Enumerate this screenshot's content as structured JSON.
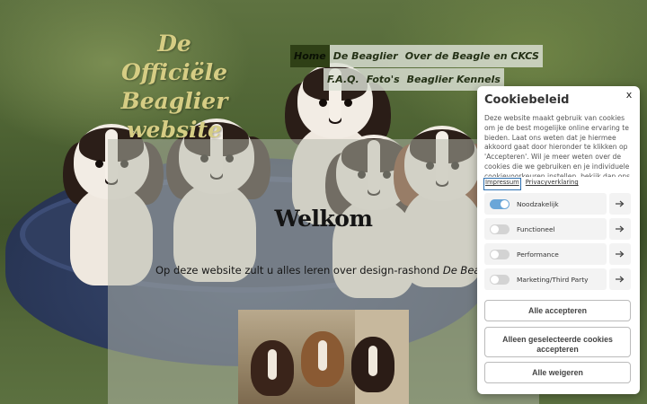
{
  "site": {
    "logo_lines": [
      "De Officiële",
      "Beaglier",
      "website"
    ]
  },
  "nav": {
    "row1": [
      "Home",
      "De Beaglier",
      "Over de Beagle en CKCS"
    ],
    "row2": [
      "F.A.Q.",
      "Foto's",
      "Beaglier Kennels"
    ],
    "active": "Home"
  },
  "main": {
    "heading": "Welkom",
    "intro_prefix": "Op deze website zult u alles leren over design-rashond ",
    "intro_emphasis": "De Beaglier"
  },
  "cookie": {
    "title": "Cookiebeleid",
    "close": "x",
    "text": "Deze website maakt gebruik van cookies om je de best mogelijke online ervaring te bieden. Laat ons weten dat je hiermee akkoord gaat door hieronder te klikken op 'Accepteren'. Wil je meer weten over de cookies die we gebruiken en je individuele cookievoorkeuren instellen, bekijk dan ons Cookiebeleid.",
    "links": [
      "Impressum",
      "Privacyverklaring"
    ],
    "categories": [
      {
        "label": "Noodzakelijk",
        "enabled": true
      },
      {
        "label": "Functioneel",
        "enabled": false
      },
      {
        "label": "Performance",
        "enabled": false
      },
      {
        "label": "Marketing/Third Party",
        "enabled": false
      }
    ],
    "buttons": {
      "accept_all": "Alle accepteren",
      "accept_selected": "Alleen geselecteerde cookies accepteren",
      "reject_all": "Alle weigeren"
    }
  },
  "colors": {
    "logo": "#d6cd84",
    "nav_active": "#2f4016",
    "toggle_on": "#6aa6d8"
  },
  "icons": {
    "category_arrow": "arrow-right-icon",
    "close": "close-icon"
  }
}
